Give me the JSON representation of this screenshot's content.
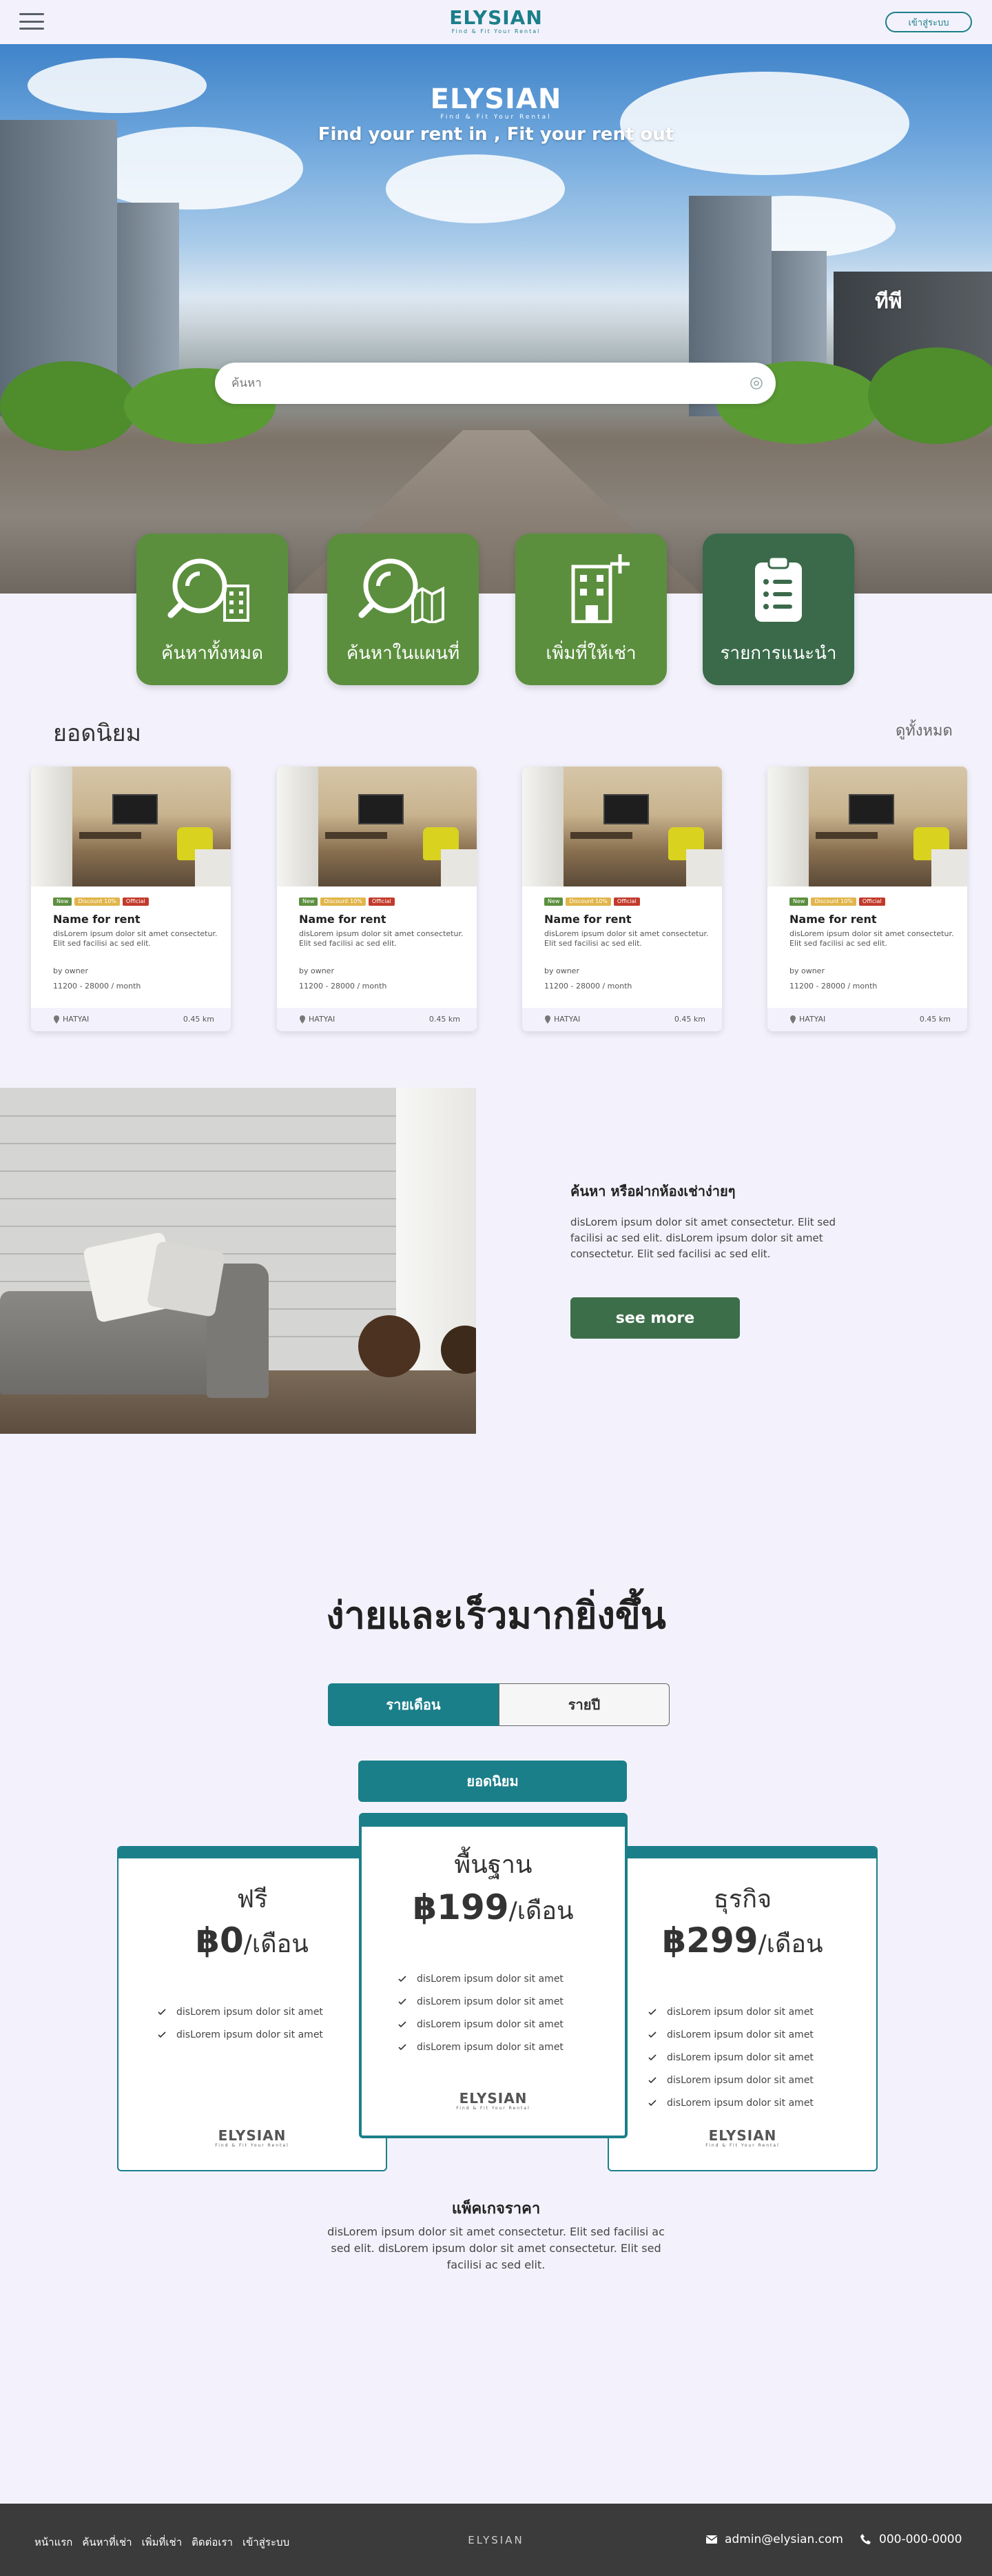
{
  "header": {
    "menu_icon": "hamburger-menu-icon",
    "logo_text": "ELYSIAN",
    "logo_sub": "Find & Fit Your Rental",
    "login_label": "เข้าสู่ระบบ"
  },
  "hero": {
    "logo_text": "ELYSIAN",
    "logo_sub": "Find & Fit Your Rental",
    "tagline": "Find your rent in , Fit your rent out",
    "side_text": "ทีพี",
    "search_placeholder": "ค้นหา"
  },
  "categories": [
    {
      "label": "ค้นหาทั้งหมด",
      "icon": "search-building-icon"
    },
    {
      "label": "ค้นหาในแผนที่",
      "icon": "search-map-icon"
    },
    {
      "label": "เพิ่มที่ให้เช่า",
      "icon": "add-building-icon"
    },
    {
      "label": "รายการแนะนำ",
      "icon": "clipboard-list-icon"
    }
  ],
  "popular": {
    "title": "ยอดนิยม",
    "view_all": "ดูทั้งหมด",
    "cards": [
      {
        "tags": [
          "New",
          "Discount 10%",
          "Official"
        ],
        "name": "Name for rent",
        "desc": "disLorem ipsum dolor sit amet consectetur. Elit sed facilisi ac sed elit.",
        "owner": "by owner",
        "price": "11200 - 28000 / month",
        "location": "HATYAI",
        "distance": "0.45 km"
      },
      {
        "tags": [
          "New",
          "Discount 10%",
          "Official"
        ],
        "name": "Name for rent",
        "desc": "disLorem ipsum dolor sit amet consectetur. Elit sed facilisi ac sed elit.",
        "owner": "by owner",
        "price": "11200 - 28000 / month",
        "location": "HATYAI",
        "distance": "0.45 km"
      },
      {
        "tags": [
          "New",
          "Discount 10%",
          "Official"
        ],
        "name": "Name for rent",
        "desc": "disLorem ipsum dolor sit amet consectetur. Elit sed facilisi ac sed elit.",
        "owner": "by owner",
        "price": "11200 - 28000 / month",
        "location": "HATYAI",
        "distance": "0.45 km"
      },
      {
        "tags": [
          "New",
          "Discount 10%",
          "Official"
        ],
        "name": "Name for rent",
        "desc": "disLorem ipsum dolor sit amet consectetur. Elit sed facilisi ac sed elit.",
        "owner": "by owner",
        "price": "11200 - 28000 / month",
        "location": "HATYAI",
        "distance": "0.45 km"
      }
    ]
  },
  "promo": {
    "title": "ค้นหา หรือฝากห้องเช่าง่ายๆ",
    "desc": "disLorem ipsum dolor sit amet consectetur. Elit sed facilisi ac sed elit. disLorem ipsum dolor sit amet consectetur. Elit sed facilisi ac sed elit.",
    "button": "see more"
  },
  "pricing": {
    "title": "ง่ายและเร็วมากยิ่งขึ้น",
    "tab_month": "รายเดือน",
    "tab_year": "รายปี",
    "popular_badge": "ยอดนิยม",
    "plans": [
      {
        "name": "ฟรี",
        "price": "฿0",
        "unit": "/เดือน",
        "features": [
          "disLorem ipsum dolor sit amet",
          "disLorem ipsum dolor sit amet"
        ]
      },
      {
        "name": "พื้นฐาน",
        "price": "฿199",
        "unit": "/เดือน",
        "features": [
          "disLorem ipsum dolor sit amet",
          "disLorem ipsum dolor sit amet",
          "disLorem ipsum dolor sit amet",
          "disLorem ipsum dolor sit amet"
        ]
      },
      {
        "name": "ธุรกิจ",
        "price": "฿299",
        "unit": "/เดือน",
        "features": [
          "disLorem ipsum dolor sit amet",
          "disLorem ipsum dolor sit amet",
          "disLorem ipsum dolor sit amet",
          "disLorem ipsum dolor sit amet",
          "disLorem ipsum dolor sit amet"
        ]
      }
    ],
    "plan_logo": "ELYSIAN",
    "plan_logo_sub": "Find & Fit Your Rental",
    "negotiate_title": "แพ็คเกจราคา",
    "negotiate_desc": "disLorem ipsum dolor sit amet consectetur. Elit sed facilisi ac sed elit. disLorem ipsum dolor sit amet consectetur. Elit sed facilisi ac sed elit."
  },
  "footer": {
    "nav": [
      "หน้าแรก",
      "ค้นหาที่เช่า",
      "เพิ่มที่เช่า",
      "ติดต่อเรา",
      "เข้าสู่ระบบ"
    ],
    "logo": "ELYSIAN",
    "email": "admin@elysian.com",
    "phone": "000-000-0000"
  },
  "colors": {
    "brand_teal": "#1b7f8a",
    "green": "#5b8f3e",
    "dark_green": "#3a6a4a",
    "background": "#f3f2fc",
    "footer": "#3b3b3b"
  }
}
